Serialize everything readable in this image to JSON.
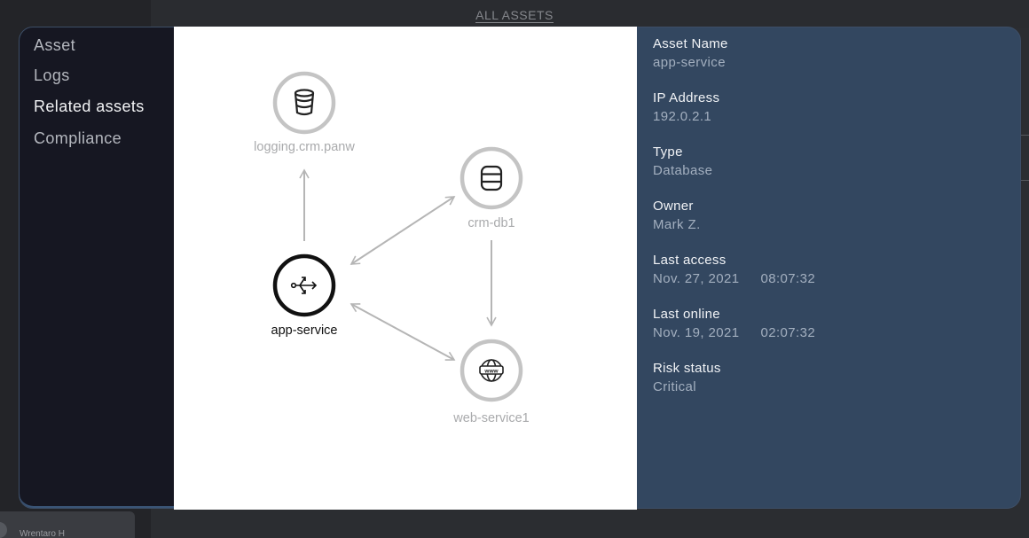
{
  "background": {
    "title": "ALL ASSETS",
    "user_name": "Wrentaro H"
  },
  "nav": {
    "items": [
      {
        "label": "Asset",
        "active": false
      },
      {
        "label": "Logs",
        "active": false
      },
      {
        "label": "Related assets",
        "active": true
      },
      {
        "label": "Compliance",
        "active": false
      }
    ]
  },
  "graph": {
    "nodes": [
      {
        "id": "logging",
        "label": "logging.crm.panw",
        "icon": "database-cylinder-icon"
      },
      {
        "id": "crmdb",
        "label": "crm-db1",
        "icon": "database-icon"
      },
      {
        "id": "app",
        "label": "app-service",
        "icon": "service-share-icon",
        "selected": true
      },
      {
        "id": "web",
        "label": "web-service1",
        "icon": "www-globe-icon"
      }
    ],
    "edges": [
      {
        "from": "app",
        "to": "logging",
        "direction": "forward"
      },
      {
        "from": "app",
        "to": "crmdb",
        "direction": "both"
      },
      {
        "from": "crmdb",
        "to": "web",
        "direction": "forward"
      },
      {
        "from": "app",
        "to": "web",
        "direction": "both"
      }
    ]
  },
  "details": {
    "asset_name": {
      "label": "Asset Name",
      "value": "app-service"
    },
    "ip_address": {
      "label": "IP Address",
      "value": "192.0.2.1"
    },
    "type": {
      "label": "Type",
      "value": "Database"
    },
    "owner": {
      "label": "Owner",
      "value": "Mark Z."
    },
    "last_access": {
      "label": "Last access",
      "date": "Nov. 27, 2021",
      "time": "08:07:32"
    },
    "last_online": {
      "label": "Last online",
      "date": "Nov. 19, 2021",
      "time": "02:07:32"
    },
    "risk_status": {
      "label": "Risk status",
      "value": "Critical"
    }
  },
  "colors": {
    "modal_bg": "#334760",
    "nav_bg": "#161722",
    "node_ring": "#c4c4c4",
    "node_ring_selected": "#111111",
    "edge": "#b5b5b5"
  }
}
